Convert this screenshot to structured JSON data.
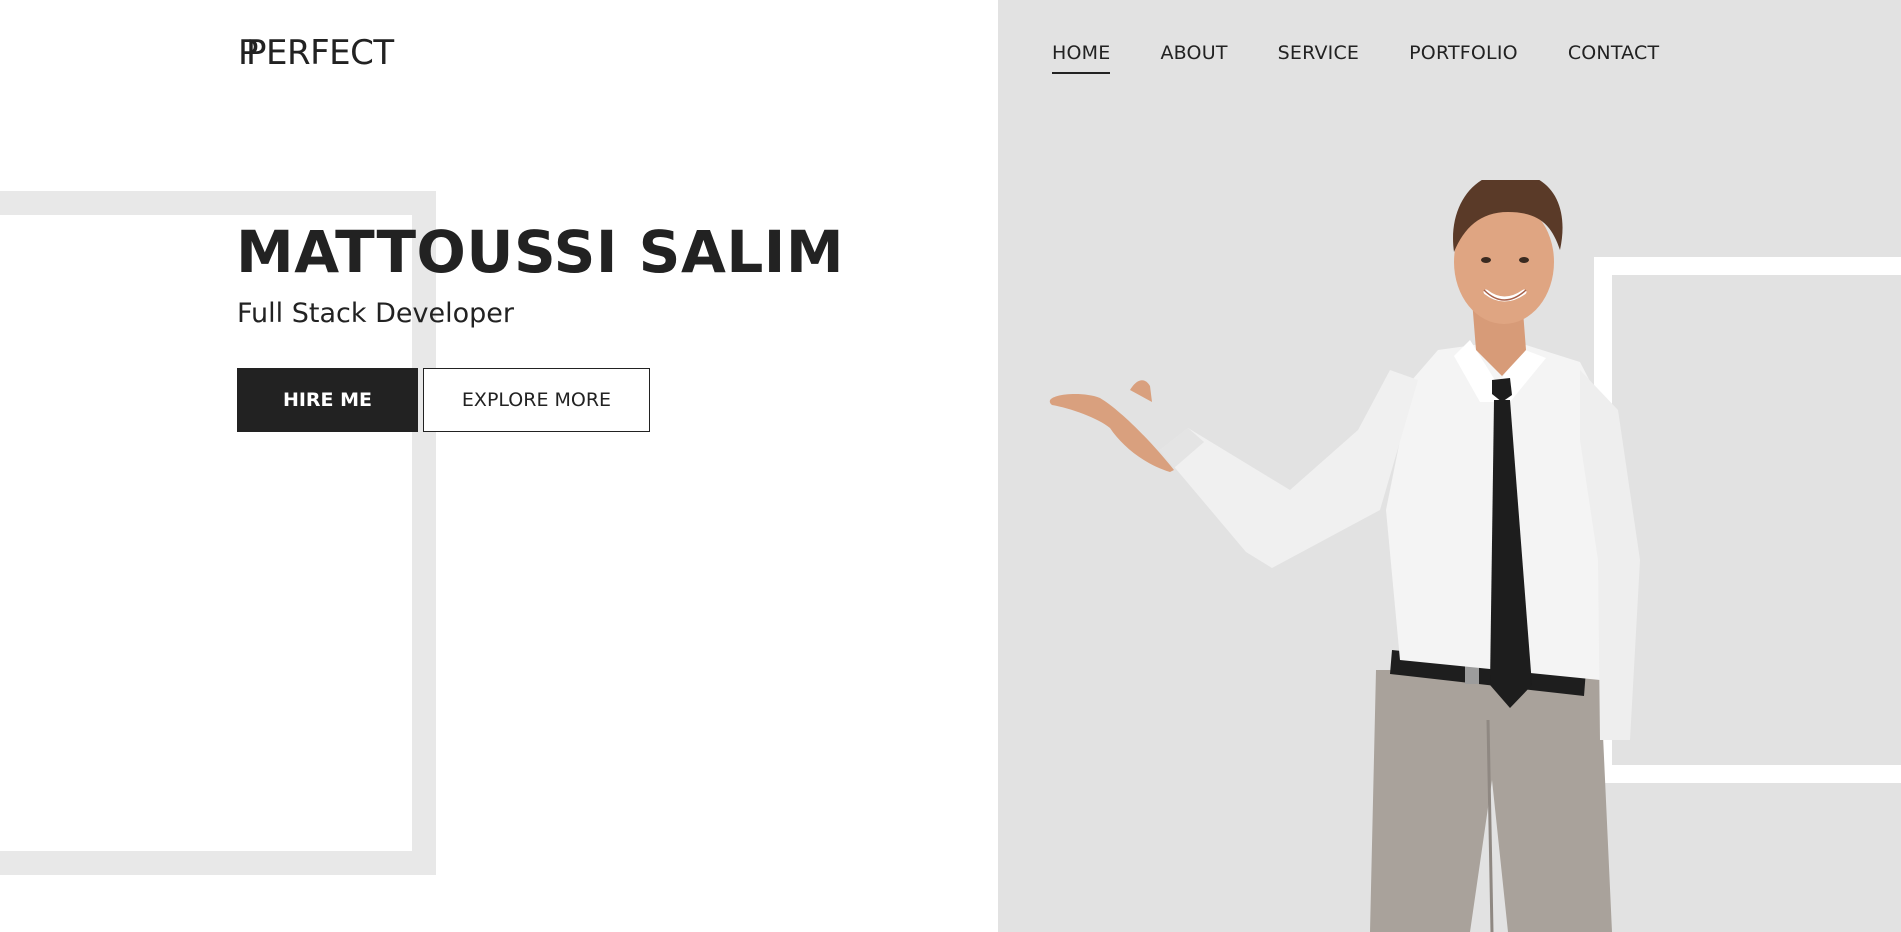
{
  "logo": {
    "mark": "P",
    "text": "ERFECT"
  },
  "nav": {
    "items": [
      {
        "label": "HOME",
        "active": true
      },
      {
        "label": "ABOUT",
        "active": false
      },
      {
        "label": "SERVICE",
        "active": false
      },
      {
        "label": "PORTFOLIO",
        "active": false
      },
      {
        "label": "CONTACT",
        "active": false
      }
    ]
  },
  "hero": {
    "title": "MATTOUSSI SALIM",
    "subtitle": "Full Stack Developer",
    "primary_button": "HIRE ME",
    "secondary_button": "EXPLORE MORE"
  },
  "colors": {
    "text": "#222222",
    "panel": "#e2e2e2",
    "frame": "#e8e8e8",
    "button_dark": "#222222"
  }
}
